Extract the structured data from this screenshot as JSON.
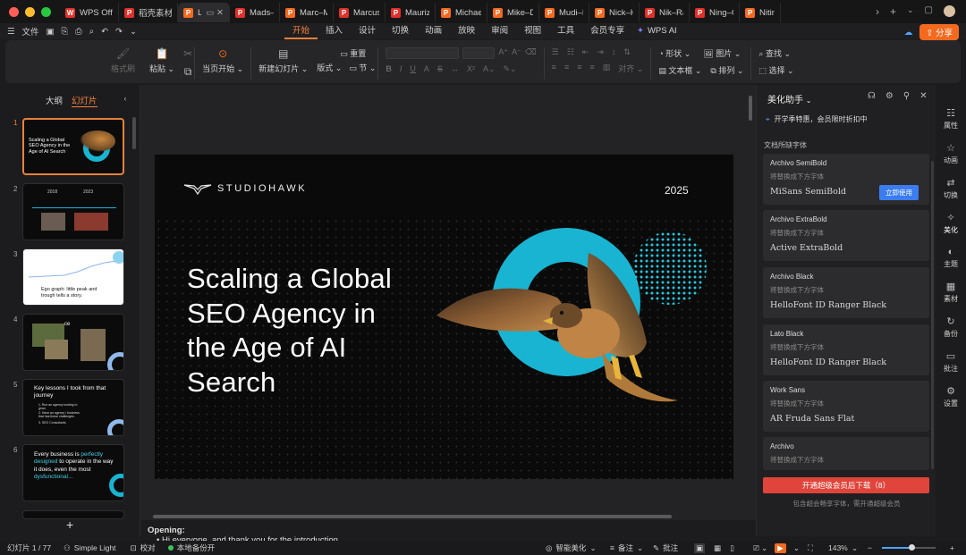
{
  "tabs": {
    "items": [
      {
        "label": "WPS Office",
        "icon": "wps-logo",
        "color": "#e0302a"
      },
      {
        "label": "稻壳素材",
        "icon": "docer-icon",
        "color": "#e0302a"
      },
      {
        "label": "La",
        "icon": "slide-file-icon",
        "color": "#f36a1f",
        "active": true
      },
      {
        "label": "Mads–Si",
        "icon": "pdf-file-icon",
        "color": "#e0302a"
      },
      {
        "label": "Marc–Mc",
        "icon": "slide-file-icon",
        "color": "#f36a1f"
      },
      {
        "label": "Marcus–I",
        "icon": "pdf-file-icon",
        "color": "#e0302a"
      },
      {
        "label": "Maurizio",
        "icon": "pdf-file-icon",
        "color": "#e0302a"
      },
      {
        "label": "Michael–",
        "icon": "slide-file-icon",
        "color": "#f36a1f"
      },
      {
        "label": "Mike–De",
        "icon": "slide-file-icon",
        "color": "#f36a1f"
      },
      {
        "label": "Mudi–Ele",
        "icon": "slide-file-icon",
        "color": "#f36a1f"
      },
      {
        "label": "Nick–Hu",
        "icon": "slide-file-icon",
        "color": "#f36a1f"
      },
      {
        "label": "Nik–Rang",
        "icon": "pdf-file-icon",
        "color": "#e0302a"
      },
      {
        "label": "Ning–Ga",
        "icon": "pdf-file-icon",
        "color": "#e0302a"
      },
      {
        "label": "Nitin–I",
        "icon": "slide-file-icon",
        "color": "#f36a1f"
      }
    ]
  },
  "menubar": {
    "file_label": "文件",
    "tabs": [
      "开始",
      "插入",
      "设计",
      "切换",
      "动画",
      "放映",
      "审阅",
      "视图",
      "工具",
      "会员专享"
    ],
    "active_tab": "开始",
    "wps_ai_label": "WPS AI",
    "share_label": "分享"
  },
  "ribbon": {
    "format_painter": "格式刷",
    "paste": "粘贴",
    "play_from_current": "当页开始",
    "new_slide": "新建幻灯片",
    "layout": "版式",
    "section": "节",
    "reset": "重置",
    "align": "对齐",
    "shape": "形状",
    "picture": "图片",
    "textbox": "文本框",
    "arrange": "排列",
    "find": "查找",
    "select": "选择"
  },
  "left_panel": {
    "outline_tab": "大纲",
    "slides_tab": "幻灯片",
    "add_label": "+",
    "thumbs": [
      {
        "num": "1",
        "title": "Scaling a Global SEO Agency in the Age of AI Search"
      },
      {
        "num": "2",
        "col1": "2018",
        "col2": "2023"
      },
      {
        "num": "3",
        "caption": "Ego graph: little peak and trough tells a story."
      },
      {
        "num": "4",
        "title": "ce"
      },
      {
        "num": "5",
        "title": "Key lessons I took from that journey",
        "items": [
          "1. Run an agency looking to grow.",
          "2. Have an agency / business that has these challenges.",
          "3. SEO Consultants"
        ]
      },
      {
        "num": "6",
        "line1": "Every business is",
        "highlight1": "perfectly designed",
        "line2": "to operate in the way it does, even the most",
        "highlight2": "dysfunctional..."
      }
    ]
  },
  "slide": {
    "brand": "STUDIOHAWK",
    "year": "2025",
    "title_lines": [
      "Scaling a Global",
      "SEO Agency in",
      "the Age of AI",
      "Search"
    ],
    "accent_color": "#19b4d2"
  },
  "notes": {
    "heading": "Opening:",
    "first_line": "Hi everyone, and thank you for the introduction."
  },
  "right_panel": {
    "title": "美化助手",
    "promo": "开学季特惠，会员限时折扣中",
    "section_label": "文档所缺字体",
    "items": [
      {
        "name": "Archivo SemiBold",
        "sub": "将替换成下方字体",
        "replacement": "MiSans SemiBold",
        "button": "立即使用"
      },
      {
        "name": "Archivo ExtraBold",
        "sub": "将替换成下方字体",
        "replacement": "Active ExtraBold"
      },
      {
        "name": "Archivo Black",
        "sub": "将替换成下方字体",
        "replacement": "HelloFont ID Ranger Black"
      },
      {
        "name": "Lato Black",
        "sub": "将替换成下方字体",
        "replacement": "HelloFont ID Ranger Black"
      },
      {
        "name": "Work Sans",
        "sub": "将替换成下方字体",
        "replacement": "AR Fruda Sans Flat"
      },
      {
        "name": "Archivo",
        "sub": "将替换成下方字体",
        "replacement": ""
      }
    ],
    "cta": "开通超级会员后下载（8）",
    "footnote": "包含超会畅享字体，需开通超级会员"
  },
  "sidebar": {
    "items": [
      {
        "label": "属性",
        "icon": "properties-icon"
      },
      {
        "label": "动画",
        "icon": "animation-icon"
      },
      {
        "label": "切换",
        "icon": "transition-icon"
      },
      {
        "label": "美化",
        "icon": "beautify-icon",
        "active": true
      },
      {
        "label": "主题",
        "icon": "theme-icon"
      },
      {
        "label": "素材",
        "icon": "material-icon"
      },
      {
        "label": "备份",
        "icon": "backup-icon"
      },
      {
        "label": "批注",
        "icon": "comment-icon"
      },
      {
        "label": "设置",
        "icon": "settings-icon"
      }
    ]
  },
  "statusbar": {
    "slide_counter": "幻灯片 1 / 77",
    "theme": "Simple Light",
    "proofread": "校对",
    "backup": "本地备份开",
    "smart_beautify": "智能美化",
    "notes": "备注",
    "comments": "批注",
    "zoom": "143%",
    "zoom_level": 0.55
  }
}
